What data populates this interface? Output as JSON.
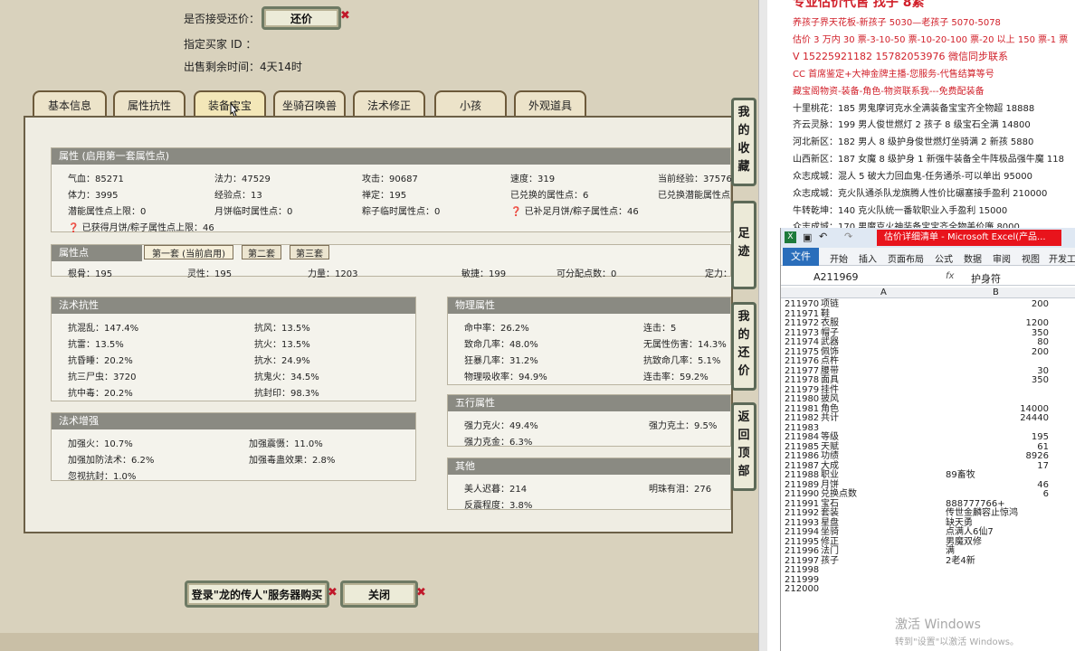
{
  "game": {
    "accept_counter_label": "是否接受还价：",
    "counter_button": "还价",
    "buyer_label": "指定买家 ID ：",
    "remaining_label": "出售剩余时间：",
    "remaining_value": "4天14时",
    "tabs": [
      "基本信息",
      "属性抗性",
      "装备宝宝",
      "坐骑召唤兽",
      "法术修正",
      "小孩",
      "外观道具"
    ],
    "side_buttons": [
      [
        "我",
        "的",
        "收",
        "藏"
      ],
      [
        "足",
        "迹"
      ],
      [
        "我",
        "的",
        "还",
        "价"
      ],
      [
        "返",
        "回",
        "顶",
        "部"
      ]
    ],
    "attr": {
      "header": "属性 (启用第一套属性点)",
      "rows": [
        [
          "气血：85271",
          "法力：47529",
          "攻击：90687",
          "速度：319",
          "当前经验：37576"
        ],
        [
          "体力：3995",
          "经验点：13",
          "禅定：195",
          "已兑换的属性点：6",
          "已兑换潜能属性点"
        ],
        [
          "潜能属性点上限：0",
          "月饼临时属性点：0",
          "粽子临时属性点：0",
          "已补足月饼/粽子属性点：46",
          ""
        ]
      ],
      "extra": "已获得月饼/粽子属性点上限：46"
    },
    "points": {
      "header": "属性点",
      "subtabs": [
        "第一套 (当前启用)",
        "第二套",
        "第三套"
      ],
      "values": [
        "根骨：195",
        "灵性：195",
        "力量：1203",
        "敏捷：199",
        "可分配点数：0",
        "定力："
      ]
    },
    "resist": {
      "header": "法术抗性",
      "rows": [
        [
          "抗混乱：147.4%",
          "抗风：13.5%"
        ],
        [
          "抗雷：13.5%",
          "抗火：13.5%"
        ],
        [
          "抗昏睡：20.2%",
          "抗水：24.9%"
        ],
        [
          "抗三尸虫：3720",
          "抗鬼火：34.5%"
        ],
        [
          "抗中毒：20.2%",
          "抗封印：98.3%"
        ]
      ]
    },
    "boost": {
      "header": "法术增强",
      "rows": [
        [
          "加强火：10.7%",
          "加强震慑：11.0%"
        ],
        [
          "加强加防法术：6.2%",
          "加强毒蛊效果：2.8%"
        ],
        [
          "忽视抗封：1.0%",
          ""
        ]
      ]
    },
    "physical": {
      "header": "物理属性",
      "rows": [
        [
          "命中率：26.2%",
          "连击：5"
        ],
        [
          "致命几率：48.0%",
          "无属性伤害：14.3%"
        ],
        [
          "狂暴几率：31.2%",
          "抗致命几率：5.1%"
        ],
        [
          "物理吸收率：94.9%",
          "连击率：59.2%"
        ]
      ]
    },
    "wuxing": {
      "header": "五行属性",
      "rows": [
        [
          "强力克火：49.4%",
          "强力克土：9.5%"
        ],
        [
          "强力克金：6.3%",
          ""
        ]
      ]
    },
    "other": {
      "header": "其他",
      "rows": [
        [
          "美人迟暮：214",
          "明珠有泪：276"
        ],
        [
          "反震程度：3.8%",
          ""
        ]
      ]
    },
    "login_button": "登录\"龙的传人\"服务器购买",
    "close_button": "关闭"
  },
  "ad": {
    "title_partial": "专业估价代售 找子 8紧",
    "lines": [
      "养孩子界天花板-新孩子 5030—老孩子 5070-5078",
      "估价 3 万内 30 票-3-10-50 票-10-20-100 票-20 以上 150 票-1 票",
      "V 15225921182  15782053976  微信同步联系",
      "CC 首席鉴定+大神金牌主播-您服务-代售结算等号",
      "藏宝阁物资-装备-角色-物资联系我---免费配装备",
      "十里桃花：185 男鬼摩诃克水全满装备宝宝齐全物超 18888",
      "齐云灵脉：199 男人俊世燃灯 2 孩子 8 级宝石全满 14800",
      "河北新区：182 男人 8 级护身俊世燃灯坐骑满 2 新孩 5880",
      "山西新区：187 女魔 8 级护身 1 新强牛装备全牛阵极品强牛魔 118",
      "众志成城：混人 5 破大力回血鬼-任务通杀-可以单出 95000",
      "众志成城：克火队通杀队龙旗腾人性价比碾塞接手盈利 210000",
      "牛转乾坤：140 克火队统一番软职业入手盈利 15000",
      "众志成城：170 男魔克火神装备宝宝齐全物美价廉 8000"
    ]
  },
  "excel": {
    "title": "估价详细清单 - Microsoft Excel(产品...",
    "menu": [
      "文件",
      "开始",
      "插入",
      "页面布局",
      "公式",
      "数据",
      "审阅",
      "视图",
      "开发工"
    ],
    "namebox": "A211969",
    "fx": "fx",
    "formula": "护身符",
    "col_a": "A",
    "col_b": "B",
    "rows": [
      [
        "211970",
        "项链",
        "200"
      ],
      [
        "211971",
        "鞋",
        ""
      ],
      [
        "211972",
        "衣服",
        "1200"
      ],
      [
        "211973",
        "帽子",
        "350"
      ],
      [
        "211974",
        "武器",
        "80"
      ],
      [
        "211975",
        "佩饰",
        "200"
      ],
      [
        "211976",
        "点杵",
        ""
      ],
      [
        "211977",
        "腰带",
        "30"
      ],
      [
        "211978",
        "面具",
        "350"
      ],
      [
        "211979",
        "挂件",
        ""
      ],
      [
        "211980",
        "披风",
        ""
      ],
      [
        "211981",
        "角色",
        "14000"
      ],
      [
        "211982",
        "共计",
        "24440"
      ],
      [
        "211983",
        "",
        ""
      ],
      [
        "211984",
        "等级",
        "195"
      ],
      [
        "211985",
        "天赋",
        "61"
      ],
      [
        "211986",
        "功绩",
        "8926"
      ],
      [
        "211987",
        "大成",
        "17"
      ],
      [
        "211988",
        "职业",
        "89畜牧"
      ],
      [
        "211989",
        "月饼",
        "46"
      ],
      [
        "211990",
        "兑换点数",
        "6"
      ],
      [
        "211991",
        "宝石",
        "888777766+"
      ],
      [
        "211992",
        "套装",
        "传世金麟容止惊鸿"
      ],
      [
        "211993",
        "星盘",
        "缺天勇"
      ],
      [
        "211994",
        "坐骑",
        "点满人6仙7"
      ],
      [
        "211995",
        "修正",
        "男魔双修"
      ],
      [
        "211996",
        "法门",
        "满"
      ],
      [
        "211997",
        "孩子",
        "2老4新"
      ],
      [
        "211998",
        "",
        ""
      ],
      [
        "211999",
        "",
        ""
      ],
      [
        "212000",
        "",
        ""
      ]
    ],
    "watermark_1": "激活 Windows",
    "watermark_2": "转到\"设置\"以激活 Windows。"
  }
}
